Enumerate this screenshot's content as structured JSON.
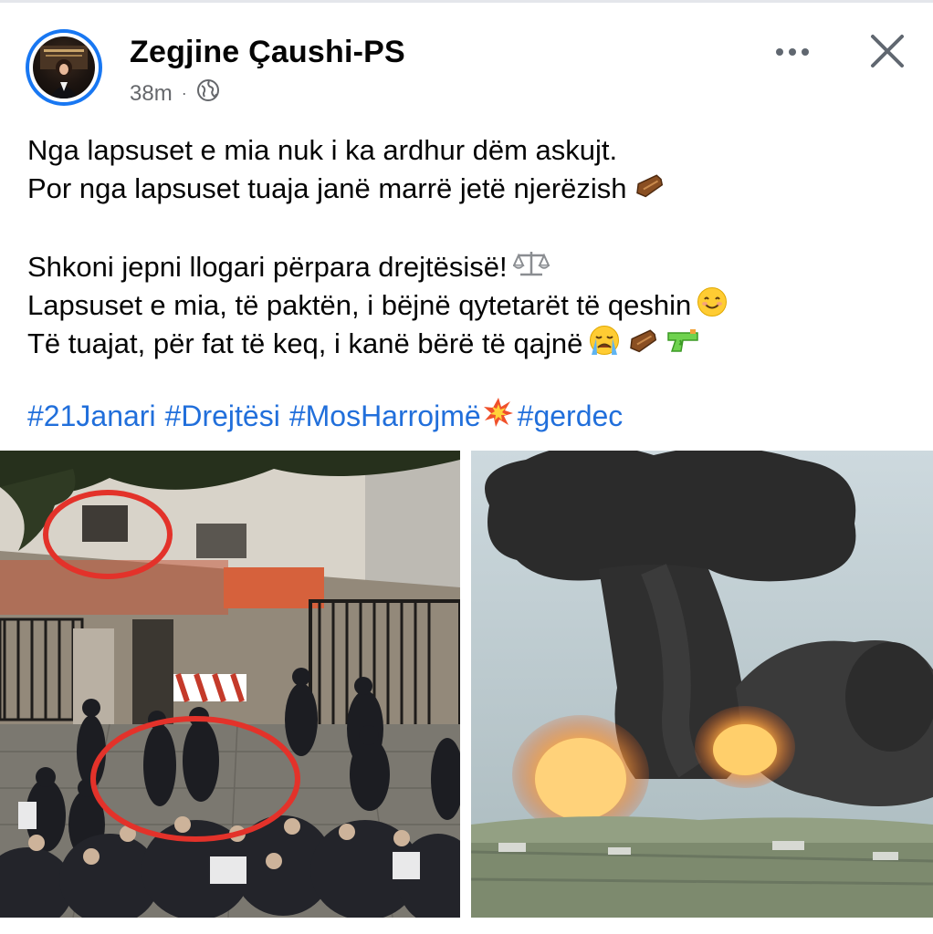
{
  "post": {
    "author": "Zegjine Çaushi-PS",
    "time": "38m",
    "separator": "·",
    "privacy_icon": "globe-icon",
    "lines": [
      "Nga lapsuset e mia nuk i ka ardhur dëm askujt.",
      "Por nga lapsuset tuaja janë marrë jetë njerëzish",
      "",
      "Shkoni jepni llogari përpara drejtësisë!",
      "Lapsuset e mia, të paktën, i bëjnë qytetarët të qeshin",
      "Të tuajat, për fat të keq, i kanë bërë të qajnë"
    ],
    "hashtags": [
      "#21Janari",
      "#Drejtësi",
      "#MosHarrojmë",
      "#gerdec"
    ],
    "colors": {
      "link": "#216fdb",
      "accent": "#1877f2",
      "muted": "#65676b"
    }
  }
}
